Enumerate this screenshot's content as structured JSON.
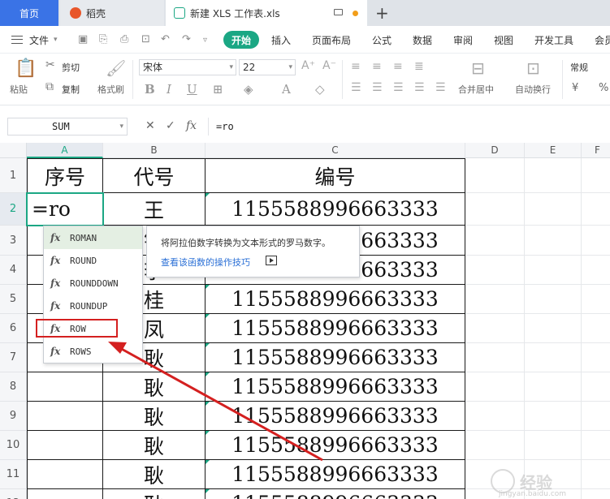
{
  "tabs": {
    "home": "首页",
    "daoke": "稻壳",
    "doc": "新建 XLS 工作表.xls",
    "new_tab": "+"
  },
  "menu": {
    "file": "文件",
    "start": "开始",
    "items": [
      "插入",
      "页面布局",
      "公式",
      "数据",
      "审阅",
      "视图",
      "开发工具",
      "会员"
    ]
  },
  "ribbon": {
    "paste": "粘贴",
    "cut": "剪切",
    "copy": "复制",
    "format_painter": "格式刷",
    "font_name": "宋体",
    "font_size": "22",
    "merge_center": "合并居中",
    "auto_wrap": "自动换行",
    "number_format": "常规",
    "currency": "¥",
    "percent": "%"
  },
  "formula_bar": {
    "name_box": "SUM",
    "cancel": "✕",
    "confirm": "✓",
    "fx": "fx",
    "formula": "=ro"
  },
  "columns": [
    "A",
    "B",
    "C",
    "D",
    "E",
    "F"
  ],
  "rows": [
    "1",
    "2",
    "3",
    "4",
    "5",
    "6",
    "7",
    "8",
    "9",
    "10",
    "11",
    "12"
  ],
  "table": {
    "headers": [
      "序号",
      "代号",
      "编号"
    ],
    "a2_editing": "=ro",
    "b_values": [
      "王",
      "钟",
      "李",
      "桂",
      "凤",
      "耿",
      "耿",
      "耿",
      "耿",
      "耿",
      "耿"
    ],
    "c_values": [
      "1155588996663333",
      "1155588996663333",
      "1155588996663333",
      "1155588996663333",
      "1155588996663333",
      "1155588996663333",
      "1155588996663333",
      "1155588996663333",
      "1155588996663333",
      "1155588996663333",
      "1155588996663333"
    ]
  },
  "autocomplete": {
    "icon_label": "fx",
    "items": [
      "ROMAN",
      "ROUND",
      "ROUNDDOWN",
      "ROUNDUP",
      "ROW",
      "ROWS"
    ],
    "selected": "ROMAN",
    "highlighted": "ROW",
    "tooltip_text": "将阿拉伯数字转换为文本形式的罗马数字。",
    "tooltip_link": "查看该函数的操作技巧"
  },
  "watermark": {
    "text": "经验",
    "sub": "jingyan.baidu.com"
  },
  "colors": {
    "accent_green": "#1ba784",
    "home_tab": "#3a73e6",
    "annotation_red": "#d42020"
  }
}
